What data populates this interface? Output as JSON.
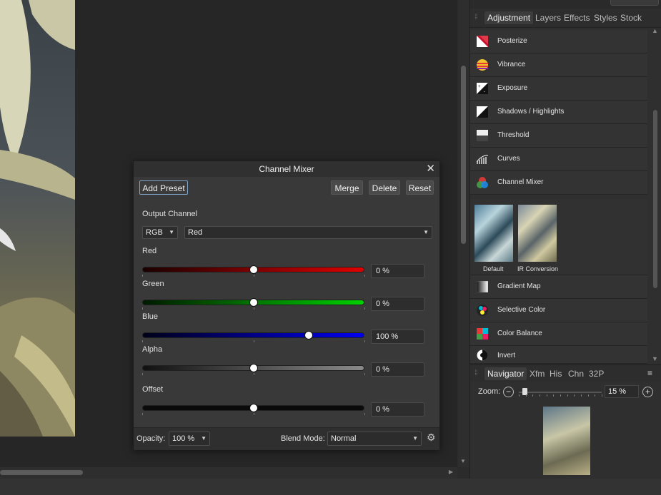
{
  "right_panel": {
    "tabs": [
      "Adjustment",
      "Layers",
      "Effects",
      "Styles",
      "Stock"
    ],
    "active_tab": "Adjustment",
    "adjustments": [
      {
        "label": "Posterize",
        "icon": "posterize-icon"
      },
      {
        "label": "Vibrance",
        "icon": "vibrance-icon"
      },
      {
        "label": "Exposure",
        "icon": "exposure-icon"
      },
      {
        "label": "Shadows / Highlights",
        "icon": "shadows-highlights-icon"
      },
      {
        "label": "Threshold",
        "icon": "threshold-icon"
      },
      {
        "label": "Curves",
        "icon": "curves-icon"
      },
      {
        "label": "Channel Mixer",
        "icon": "channel-mixer-icon"
      },
      {
        "label": "Gradient Map",
        "icon": "gradient-map-icon"
      },
      {
        "label": "Selective Color",
        "icon": "selective-color-icon"
      },
      {
        "label": "Color Balance",
        "icon": "color-balance-icon"
      },
      {
        "label": "Invert",
        "icon": "invert-icon"
      }
    ],
    "presets": [
      {
        "label": "Default"
      },
      {
        "label": "IR Conversion"
      }
    ]
  },
  "navigator": {
    "tabs": [
      "Navigator",
      "Xfm",
      "His",
      "Chn",
      "32P"
    ],
    "active_tab": "Navigator",
    "zoom_label": "Zoom:",
    "zoom_value": "15 %",
    "zoom_fraction": 0.04
  },
  "dialog": {
    "title": "Channel Mixer",
    "add_preset": "Add Preset",
    "merge": "Merge",
    "delete": "Delete",
    "reset": "Reset",
    "output_channel_label": "Output Channel",
    "color_space": "RGB",
    "output_channel": "Red",
    "sliders": [
      {
        "label": "Red",
        "value": "0 %",
        "position": 0.5,
        "gradient": [
          "#1a0000",
          "#e00000"
        ]
      },
      {
        "label": "Green",
        "value": "0 %",
        "position": 0.5,
        "gradient": [
          "#001a00",
          "#00d000"
        ]
      },
      {
        "label": "Blue",
        "value": "100 %",
        "position": 0.75,
        "gradient": [
          "#00001a",
          "#0000f0"
        ]
      },
      {
        "label": "Alpha",
        "value": "0 %",
        "position": 0.5,
        "gradient": [
          "#111111",
          "#8a8a8a"
        ]
      },
      {
        "label": "Offset",
        "value": "0 %",
        "position": 0.5,
        "gradient": [
          "#0a0a0a",
          "#0a0a0a"
        ]
      }
    ],
    "opacity_label": "Opacity:",
    "opacity_value": "100 %",
    "blend_mode_label": "Blend Mode:",
    "blend_mode_value": "Normal"
  },
  "colors": {
    "accent_outline": "#7fa4c8"
  }
}
